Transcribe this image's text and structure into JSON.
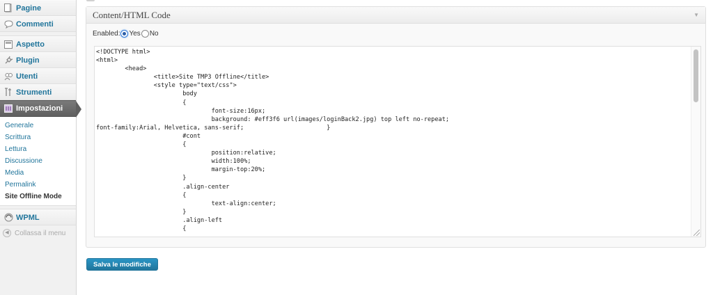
{
  "sidebar": {
    "top_items": [
      {
        "label": "Pagine",
        "icon": "page-icon"
      },
      {
        "label": "Commenti",
        "icon": "comment-bubble-icon"
      }
    ],
    "mid_items": [
      {
        "label": "Aspetto",
        "icon": "appearance-icon"
      },
      {
        "label": "Plugin",
        "icon": "plug-icon"
      },
      {
        "label": "Utenti",
        "icon": "users-icon"
      },
      {
        "label": "Strumenti",
        "icon": "tools-icon"
      }
    ],
    "current": {
      "label": "Impostazioni",
      "icon": "settings-icon"
    },
    "submenu": [
      "Generale",
      "Scrittura",
      "Lettura",
      "Discussione",
      "Media",
      "Permalink",
      "Site Offline Mode"
    ],
    "submenu_current_index": 6,
    "wpml": {
      "label": "WPML",
      "icon": "wpml-icon"
    },
    "collapse_label": "Collassa il menu"
  },
  "postbox": {
    "title": "Content/HTML Code",
    "enabled_label": "Enabled:",
    "yes_label": "Yes",
    "no_label": "No",
    "enabled_value": "Yes",
    "code": "<!DOCTYPE html>\n<html>\n\t<head>\n\t\t<title>Site TMP3 Offline</title>\n\t\t<style type=\"text/css\">\n\t\t\tbody\n\t\t\t{\n\t\t\t\tfont-size:16px;\n\t\t\t\tbackground: #eff3f6 url(images/loginBack2.jpg) top left no-repeat;\nfont-family:Arial, Helvetica, sans-serif;\t\t\t}\n\t\t\t#cont\n\t\t\t{\n\t\t\t\tposition:relative;\n\t\t\t\twidth:100%;\n\t\t\t\tmargin-top:20%;\n\t\t\t}\n\t\t\t.align-center\n\t\t\t{\n\t\t\t\ttext-align:center;\n\t\t\t}\n\t\t\t.align-left\n\t\t\t{"
  },
  "save_button_label": "Salva le modifiche",
  "colors": {
    "link": "#21759b",
    "current_menu_bg": "#5f5f5f",
    "button": "#21759b"
  }
}
